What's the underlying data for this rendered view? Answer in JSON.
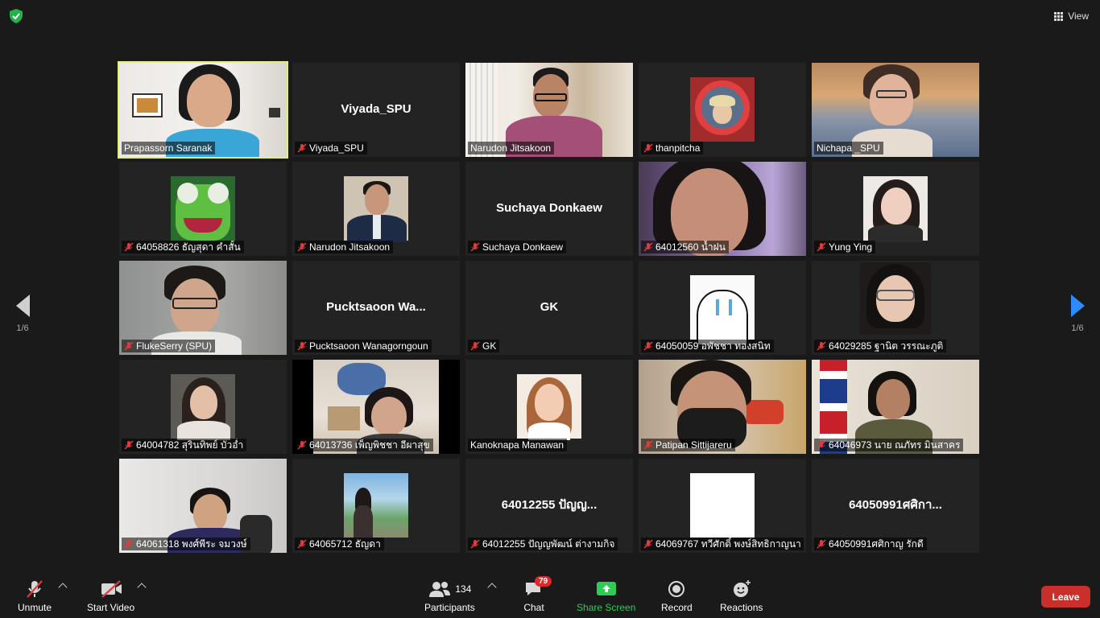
{
  "window": {
    "view_label": "View"
  },
  "pagination": {
    "left_page": "1/6",
    "right_page": "1/6"
  },
  "participants": [
    {
      "name": "Prapassorn Saranak",
      "muted": false,
      "video": true
    },
    {
      "name": "Viyada_SPU",
      "display": "Viyada_SPU",
      "muted": true,
      "video": false
    },
    {
      "name": "Narudon Jitsakoon",
      "muted": false,
      "video": true
    },
    {
      "name": "thanpitcha",
      "muted": true,
      "video": true
    },
    {
      "name": "Nichapa _SPU",
      "muted": false,
      "video": true
    },
    {
      "name": "64058826 ธัญสุดา คำสั้น",
      "muted": true,
      "video": true
    },
    {
      "name": "Narudon Jitsakoon",
      "muted": true,
      "video": true
    },
    {
      "name": "Suchaya Donkaew",
      "display": "Suchaya Donkaew",
      "muted": true,
      "video": false
    },
    {
      "name": "64012560 น้ำฝน",
      "muted": true,
      "video": true
    },
    {
      "name": "Yung Ying",
      "muted": true,
      "video": true
    },
    {
      "name": "FlukeSerry (SPU)",
      "muted": true,
      "video": true
    },
    {
      "name": "Pucktsaoon Wanagorngoun",
      "display": "Pucktsaoon  Wa...",
      "muted": true,
      "video": false
    },
    {
      "name": "GK",
      "display": "GK",
      "muted": true,
      "video": false
    },
    {
      "name": "64050059 อพัชชา ทองสนิท",
      "muted": true,
      "video": true
    },
    {
      "name": "64029285 ฐานิต วรรณะภูติ",
      "muted": true,
      "video": true
    },
    {
      "name": "64004782 สุรินทิพย์ บัวอ่ำ",
      "muted": true,
      "video": true
    },
    {
      "name": "64013736 เพ็ญพิชชา อีผาสุข",
      "muted": true,
      "video": true
    },
    {
      "name": "Kanoknapa Manawan",
      "muted": false,
      "video": true
    },
    {
      "name": "Patipan Sittijareru",
      "muted": true,
      "video": true
    },
    {
      "name": "64046973 นาย ณภัทร มินสาคร",
      "muted": true,
      "video": true
    },
    {
      "name": "64061318 พงศ์พีระ จมวงษ์",
      "muted": true,
      "video": true
    },
    {
      "name": "64065712 ธัญดา",
      "muted": true,
      "video": true
    },
    {
      "name": "64012255 ปัญญพัฒน์ ต่างามกิจ",
      "display": "64012255 ปัญญ...",
      "muted": true,
      "video": false
    },
    {
      "name": "64069767 ทวีศักดิ์ พงษ์สิทธิกาญนา",
      "muted": true,
      "video": true
    },
    {
      "name": "64050991ศศิกาญ รักดี",
      "display": "64050991ศศิกา...",
      "muted": true,
      "video": false
    }
  ],
  "toolbar": {
    "unmute": "Unmute",
    "start_video": "Start Video",
    "participants": "Participants",
    "participants_count": "134",
    "chat": "Chat",
    "chat_badge": "79",
    "share_screen": "Share Screen",
    "record": "Record",
    "reactions": "Reactions",
    "leave": "Leave"
  },
  "colors": {
    "active_speaker": "#e6f076",
    "share": "#2ecc55",
    "leave": "#c9302c",
    "accent": "#2d8cff"
  }
}
